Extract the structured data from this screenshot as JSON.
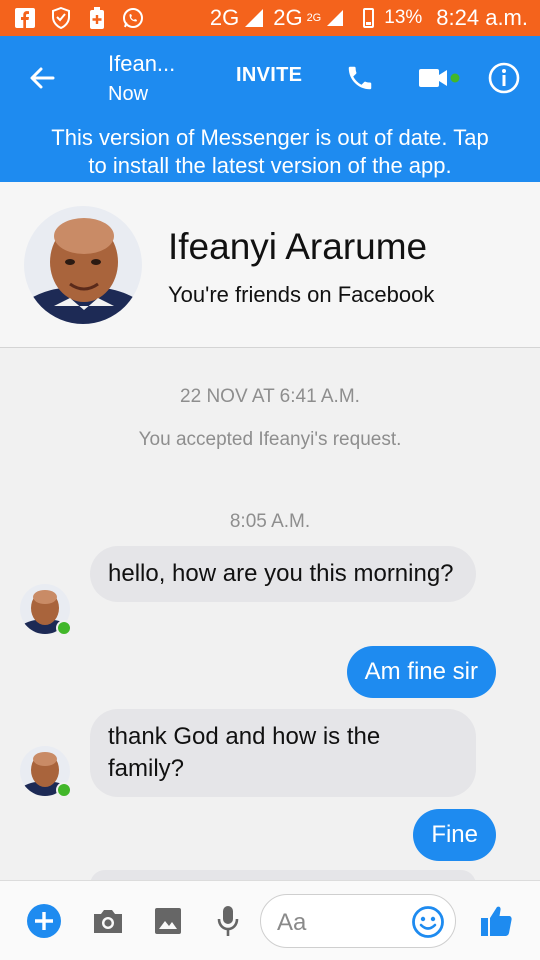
{
  "status_bar": {
    "network_1": "2G",
    "network_2": "2G",
    "network_2_badge": "2G",
    "battery": "13%",
    "time": "8:24 a.m.",
    "icons": [
      "facebook-icon",
      "shield-icon",
      "battery-plus-icon",
      "whatsapp-icon"
    ]
  },
  "header": {
    "title": "Ifean...",
    "subtitle": "Now",
    "invite_label": "INVITE",
    "icons": [
      "back-arrow-icon",
      "phone-icon",
      "video-icon",
      "info-icon"
    ]
  },
  "banner": {
    "line1": "This version of Messenger is out of date. Tap",
    "line2": "to install the latest version of the app."
  },
  "profile": {
    "name": "Ifeanyi Ararume",
    "relation": "You're friends on Facebook"
  },
  "conversation": {
    "date_stamp": "22 NOV AT 6:41 A.M.",
    "accepted_note": "You accepted Ifeanyi's request.",
    "time_stamp": "8:05 A.M.",
    "messages": [
      {
        "from": "them",
        "text": "hello, how are you this morning?"
      },
      {
        "from": "me",
        "text": "Am fine sir"
      },
      {
        "from": "them",
        "text": "thank God and how is the family?"
      },
      {
        "from": "me",
        "text": "Fine"
      }
    ]
  },
  "composer": {
    "placeholder": "Aa",
    "icons": [
      "plus-icon",
      "camera-icon",
      "gallery-icon",
      "mic-icon",
      "emoji-icon",
      "like-icon"
    ]
  },
  "colors": {
    "status_bar": "#f4631c",
    "messenger_blue": "#1e8bf0",
    "incoming_bubble": "#e5e5e8",
    "online": "#42b72a"
  }
}
